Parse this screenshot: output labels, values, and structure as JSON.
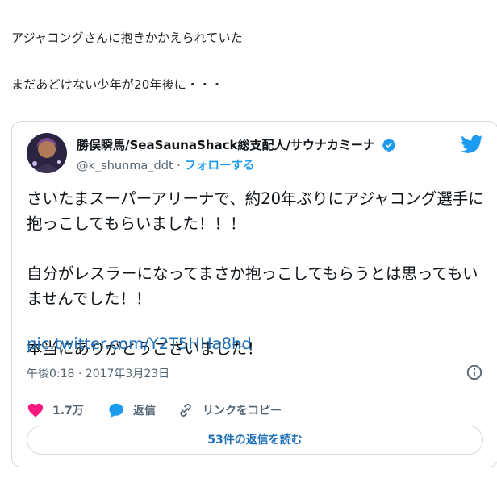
{
  "intro": {
    "line1": "アジャコングさんに抱きかかえられていた",
    "line2": "まだあどけない少年が20年後に・・・"
  },
  "tweet": {
    "author_name": "勝俣瞬馬/SeaSaunaShack総支配人/サウナカミーナ",
    "handle": "@k_shunma_ddt",
    "separator": " · ",
    "follow_label": "フォローする",
    "text": "さいたまスーパーアリーナで、約20年ぶりにアジャコング選手に抱っこしてもらいました！！！\n\n自分がレスラーになってまさか抱っこしてもらうとは思ってもいませんでした！！\n\n本当にありがとうございました！",
    "link": "pic.twitter.com/Y2T5HHa8hd",
    "timestamp": "午後0:18 · 2017年3月23日",
    "likes": "1.7万",
    "reply_label": "返信",
    "copy_link_label": "リンクをコピー",
    "read_replies_label": "53件の返信を読む"
  },
  "icons": [
    "avatar",
    "verified-badge-icon",
    "twitter-bird-icon",
    "info-icon",
    "heart-icon",
    "reply-icon",
    "link-icon"
  ],
  "colors": {
    "accent": "#1d9bf0",
    "like": "#f91880",
    "link": "#1d6fb8"
  }
}
